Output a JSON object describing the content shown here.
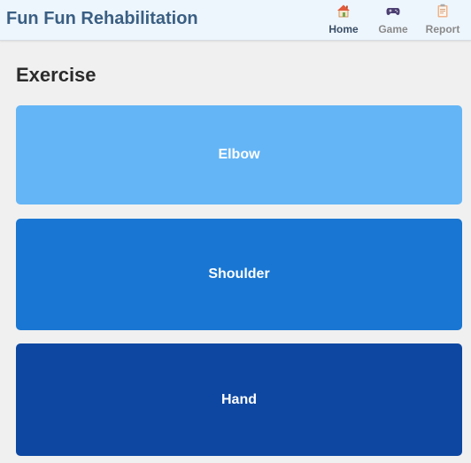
{
  "app": {
    "title": "Fun Fun Rehabilitation"
  },
  "nav": {
    "items": [
      {
        "label": "Home",
        "icon": "house-icon",
        "active": true
      },
      {
        "label": "Game",
        "icon": "gamepad-icon",
        "active": false
      },
      {
        "label": "Report",
        "icon": "clipboard-icon",
        "active": false
      }
    ]
  },
  "main": {
    "section_title": "Exercise",
    "cards": [
      {
        "label": "Elbow",
        "color": "#64b5f6"
      },
      {
        "label": "Shoulder",
        "color": "#1976d2"
      },
      {
        "label": "Hand",
        "color": "#0d47a1"
      }
    ]
  },
  "colors": {
    "header_bg": "#eef6fd",
    "title": "#3a5f83",
    "page_bg": "#f0f0f0",
    "nav_active": "#3a4e66",
    "nav_inactive": "#8a8a8a"
  }
}
